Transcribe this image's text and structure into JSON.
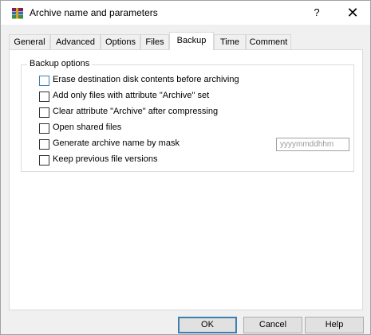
{
  "window": {
    "title": "Archive name and parameters",
    "help_glyph": "?",
    "close_glyph": "✕",
    "icon": "winrar-books-icon"
  },
  "tabs": [
    {
      "label": "General"
    },
    {
      "label": "Advanced"
    },
    {
      "label": "Options"
    },
    {
      "label": "Files"
    },
    {
      "label": "Backup",
      "active": true
    },
    {
      "label": "Time"
    },
    {
      "label": "Comment"
    }
  ],
  "backup": {
    "group_label": "Backup options",
    "options": [
      {
        "label": "Erase destination disk contents before archiving",
        "checked": false
      },
      {
        "label": "Add only files with attribute \"Archive\" set",
        "checked": false
      },
      {
        "label": "Clear attribute \"Archive\" after compressing",
        "checked": false
      },
      {
        "label": "Open shared files",
        "checked": false
      },
      {
        "label": "Generate archive name by mask",
        "checked": false
      },
      {
        "label": "Keep previous file versions",
        "checked": false
      }
    ],
    "mask_value": "yyyymmddhhm"
  },
  "buttons": {
    "ok": "OK",
    "cancel": "Cancel",
    "help": "Help"
  },
  "colors": {
    "accent": "#3c7fb1",
    "dialog_bg": "#f0f0f0"
  }
}
